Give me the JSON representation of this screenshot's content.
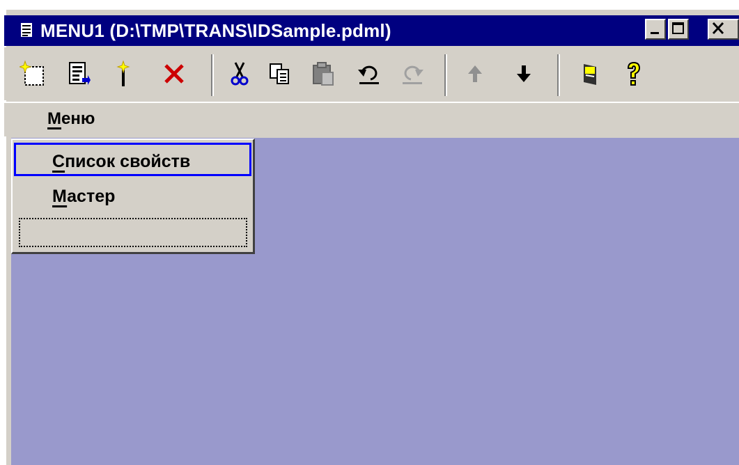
{
  "window": {
    "title": "MENU1 (D:\\TMP\\TRANS\\IDSample.pdml)",
    "icon": "document-icon",
    "controls": [
      "minimize-icon",
      "maximize-icon",
      "close-icon"
    ]
  },
  "toolbar": {
    "buttons": [
      {
        "icon": "new-item-icon"
      },
      {
        "icon": "properties-icon"
      },
      {
        "icon": "wizard-wand-icon"
      },
      {
        "icon": "delete-icon"
      },
      {
        "icon": "cut-icon"
      },
      {
        "icon": "copy-icon"
      },
      {
        "icon": "paste-icon"
      },
      {
        "icon": "undo-icon"
      },
      {
        "icon": "redo-icon"
      },
      {
        "icon": "move-up-icon"
      },
      {
        "icon": "move-down-icon"
      },
      {
        "icon": "preview-icon"
      },
      {
        "icon": "help-icon"
      }
    ]
  },
  "menubar": {
    "menu_label_underlined": "М",
    "menu_label_rest": "еню"
  },
  "popup": {
    "items": [
      {
        "u": "С",
        "rest": "писок свойств",
        "selected": true
      },
      {
        "u": "М",
        "rest": "астер",
        "selected": false
      },
      {
        "u": "",
        "rest": "",
        "placeholder": true
      }
    ]
  },
  "colors": {
    "titlebar": "#000080",
    "client": "#9999cc",
    "face": "#d4d0c8",
    "selection_border": "#0000ff",
    "delete_red": "#cc0000"
  }
}
